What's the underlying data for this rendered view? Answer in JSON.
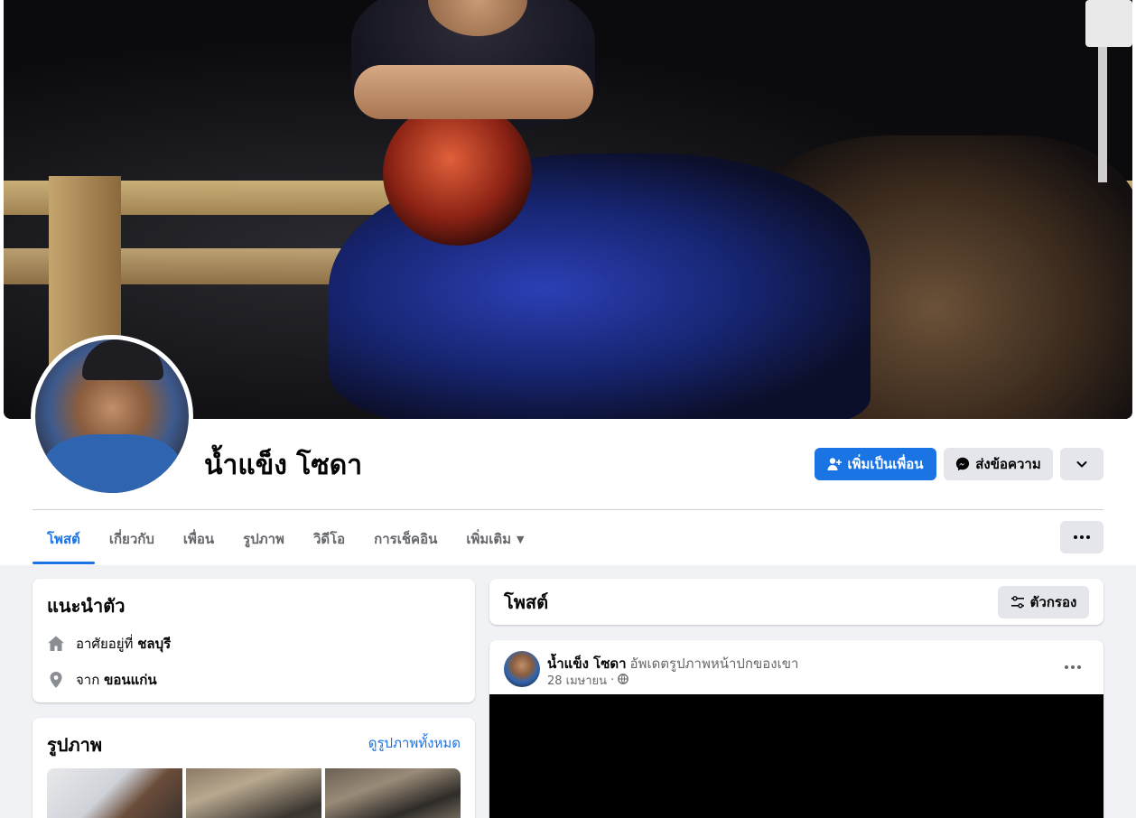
{
  "profile": {
    "name": "น้ำแข็ง โซดา"
  },
  "actions": {
    "add_friend": "เพิ่มเป็นเพื่อน",
    "message": "ส่งข้อความ"
  },
  "tabs": [
    {
      "label": "โพสต์",
      "active": true
    },
    {
      "label": "เกี่ยวกับ",
      "active": false
    },
    {
      "label": "เพื่อน",
      "active": false
    },
    {
      "label": "รูปภาพ",
      "active": false
    },
    {
      "label": "วิดีโอ",
      "active": false
    },
    {
      "label": "การเช็คอิน",
      "active": false
    },
    {
      "label": "เพิ่มเติม",
      "active": false
    }
  ],
  "intro": {
    "title": "แนะนำตัว",
    "lives_prefix": "อาศัยอยู่ที่",
    "lives_in": "ชลบุรี",
    "from_prefix": "จาก",
    "from": "ขอนแก่น"
  },
  "photos": {
    "title": "รูปภาพ",
    "see_all": "ดูรูปภาพทั้งหมด"
  },
  "posts": {
    "title": "โพสต์",
    "filter_label": "ตัวกรอง"
  },
  "post": {
    "author": "น้ำแข็ง โซดา",
    "action": "อัพเดตรูปภาพหน้าปกของเขา",
    "date": "28 เมษายน",
    "separator": "·"
  },
  "colors": {
    "accent": "#1b74e4",
    "background": "#f0f2f5",
    "button_gray": "#e4e6eb",
    "text_secondary": "#65676b"
  }
}
